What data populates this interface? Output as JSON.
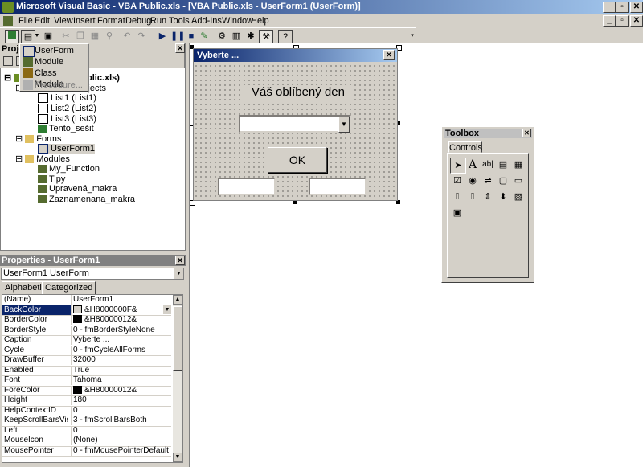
{
  "window": {
    "title": "Microsoft Visual Basic - VBA Public.xls - [VBA Public.xls - UserForm1 (UserForm)]",
    "min": "_",
    "max": "▫",
    "close": "✕"
  },
  "menu": [
    "File",
    "Edit",
    "View",
    "Insert",
    "Format",
    "Debug",
    "Run",
    "Tools",
    "Add-Ins",
    "Window",
    "Help"
  ],
  "insert_menu": {
    "items": [
      "UserForm",
      "Module",
      "Class Module",
      "Procedure..."
    ]
  },
  "project": {
    "title": "Proje",
    "tree": [
      {
        "label": "VBAProject (VBA Public.xls)",
        "visible": "ublic.xls)",
        "level": 0
      },
      {
        "label": "Microsoft Excel Objects",
        "visible": "bjects",
        "level": 1
      },
      {
        "label": "List1 (List1)",
        "level": 2
      },
      {
        "label": "List2 (List2)",
        "level": 2
      },
      {
        "label": "List3 (List3)",
        "level": 2
      },
      {
        "label": "Tento_sešit",
        "level": 2
      },
      {
        "label": "Forms",
        "level": 1
      },
      {
        "label": "UserForm1",
        "level": 2
      },
      {
        "label": "Modules",
        "level": 1
      },
      {
        "label": "My_Function",
        "level": 2
      },
      {
        "label": "Tipy",
        "level": 2
      },
      {
        "label": "Upravená_makra",
        "level": 2
      },
      {
        "label": "Zaznamenana_makra",
        "level": 2
      }
    ]
  },
  "properties": {
    "title": "Properties - UserForm1",
    "object": "UserForm1  UserForm",
    "tabs": [
      "Alphabetic",
      "Categorized"
    ],
    "rows": [
      {
        "name": "(Name)",
        "value": "UserForm1"
      },
      {
        "name": "BackColor",
        "value": "&H8000000F&",
        "swatch": "#d4d0c8"
      },
      {
        "name": "BorderColor",
        "value": "&H80000012&",
        "swatch": "#000000"
      },
      {
        "name": "BorderStyle",
        "value": "0 - fmBorderStyleNone"
      },
      {
        "name": "Caption",
        "value": "Vyberte ..."
      },
      {
        "name": "Cycle",
        "value": "0 - fmCycleAllForms"
      },
      {
        "name": "DrawBuffer",
        "value": "32000"
      },
      {
        "name": "Enabled",
        "value": "True"
      },
      {
        "name": "Font",
        "value": "Tahoma"
      },
      {
        "name": "ForeColor",
        "value": "&H80000012&",
        "swatch": "#000000"
      },
      {
        "name": "Height",
        "value": "180"
      },
      {
        "name": "HelpContextID",
        "value": "0"
      },
      {
        "name": "KeepScrollBarsVisible",
        "value": "3 - fmScrollBarsBoth"
      },
      {
        "name": "Left",
        "value": "0"
      },
      {
        "name": "MouseIcon",
        "value": "(None)"
      },
      {
        "name": "MousePointer",
        "value": "0 - fmMousePointerDefault"
      }
    ]
  },
  "userform": {
    "caption": "Vyberte ...",
    "label": "Váš oblíbený den",
    "ok": "OK"
  },
  "toolbox": {
    "title": "Toolbox",
    "tab": "Controls"
  }
}
